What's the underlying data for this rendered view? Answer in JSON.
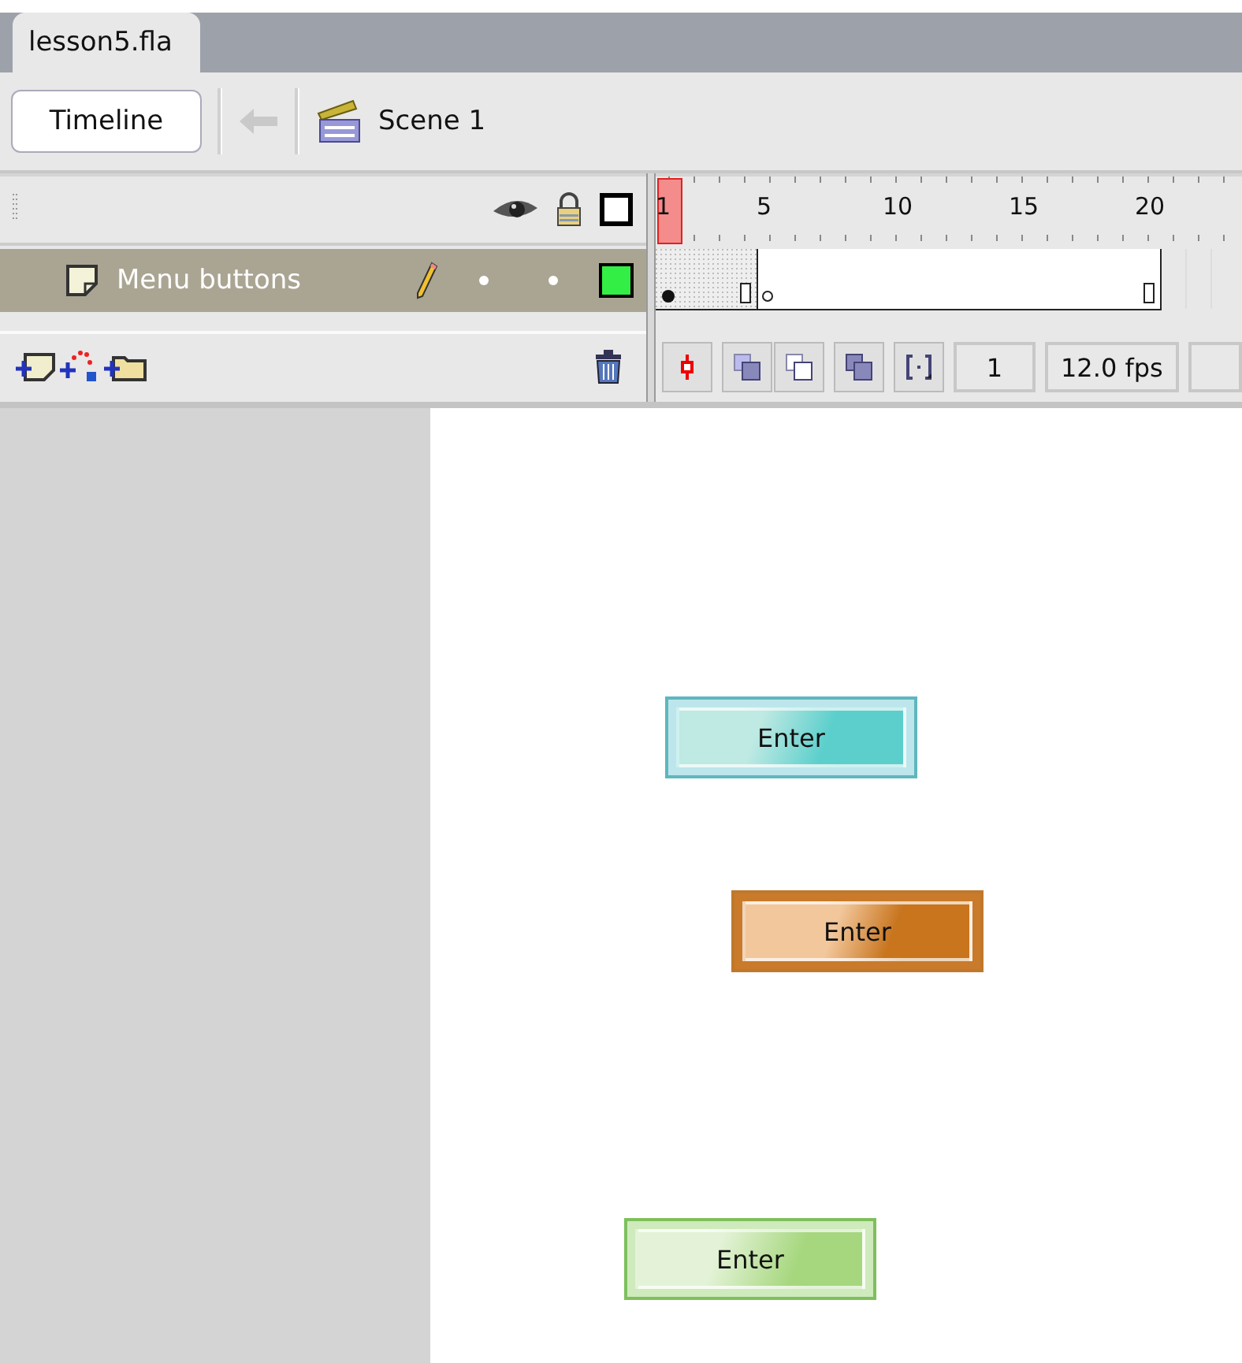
{
  "document_tab": {
    "label": "lesson5.fla",
    "selected": true
  },
  "edit_bar": {
    "timeline_button": "Timeline",
    "scene": "Scene 1"
  },
  "timeline": {
    "ruler": [
      "1",
      "5",
      "10",
      "15",
      "20"
    ],
    "layers": [
      {
        "name": "Menu buttons",
        "selected": true,
        "color": "#33ee44"
      }
    ],
    "current_frame": "1",
    "frame_rate": "12.0 fps"
  },
  "stage": {
    "buttons": [
      {
        "label": "Enter",
        "kind": "teal"
      },
      {
        "label": "Enter",
        "kind": "orange"
      },
      {
        "label": "Enter",
        "kind": "green"
      }
    ]
  }
}
